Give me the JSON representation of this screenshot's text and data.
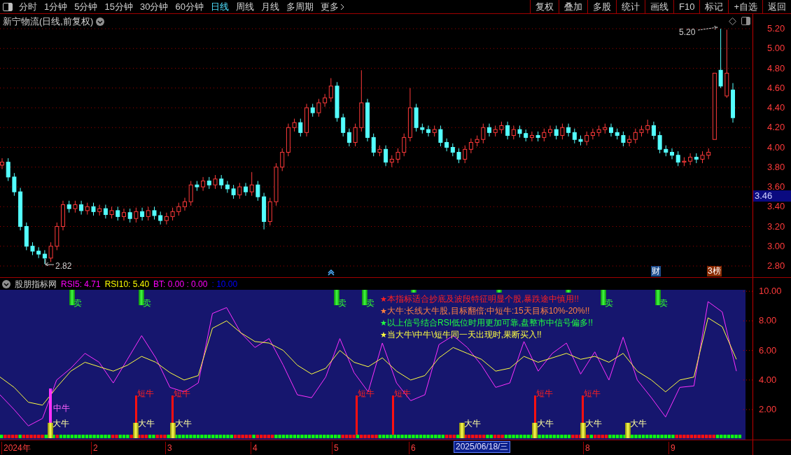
{
  "toolbar": {
    "periods": [
      {
        "label": "分时",
        "selected": false
      },
      {
        "label": "1分钟",
        "selected": false
      },
      {
        "label": "5分钟",
        "selected": false
      },
      {
        "label": "15分钟",
        "selected": false
      },
      {
        "label": "30分钟",
        "selected": false
      },
      {
        "label": "60分钟",
        "selected": false
      },
      {
        "label": "日线",
        "selected": true
      },
      {
        "label": "周线",
        "selected": false
      },
      {
        "label": "月线",
        "selected": false
      },
      {
        "label": "多周期",
        "selected": false
      }
    ],
    "more": "更多",
    "actions": [
      "复权",
      "叠加",
      "多股",
      "统计",
      "画线",
      "F10",
      "标记",
      "+自选",
      "返回"
    ]
  },
  "chart": {
    "title": "新宁物流(日线,前复权)",
    "current_price": "3.46",
    "high_marker": "5.20",
    "low_marker": "2.82",
    "event_tags": [
      {
        "label": "财",
        "color": "#1f4f8f"
      },
      {
        "label": "3榜",
        "color": "#8a2a00"
      }
    ],
    "chart_data": {
      "type": "candlestick",
      "ylim": [
        2.8,
        5.2
      ],
      "grid": true,
      "yticks": [
        {
          "value": 5.2,
          "label": "5.20"
        },
        {
          "value": 5.0,
          "label": "5.00"
        },
        {
          "value": 4.8,
          "label": "4.80"
        },
        {
          "value": 4.6,
          "label": "4.60"
        },
        {
          "value": 4.4,
          "label": "4.40"
        },
        {
          "value": 4.2,
          "label": "4.20"
        },
        {
          "value": 4.0,
          "label": "4.00"
        },
        {
          "value": 3.8,
          "label": "3.80"
        },
        {
          "value": 3.6,
          "label": "3.60"
        },
        {
          "value": 3.4,
          "label": "3.40"
        },
        {
          "value": 3.2,
          "label": "3.20"
        },
        {
          "value": 3.0,
          "label": "3.00"
        },
        {
          "value": 2.8,
          "label": "2.80"
        }
      ],
      "ohlc": [
        [
          3.82,
          3.89,
          3.78,
          3.85
        ],
        [
          3.85,
          3.89,
          3.66,
          3.7
        ],
        [
          3.7,
          3.74,
          3.51,
          3.55
        ],
        [
          3.55,
          3.59,
          3.16,
          3.2
        ],
        [
          3.2,
          3.24,
          2.96,
          3.0
        ],
        [
          3.0,
          3.04,
          2.91,
          2.95
        ],
        [
          2.95,
          2.99,
          2.88,
          2.92
        ],
        [
          2.92,
          2.96,
          2.82,
          2.88
        ],
        [
          2.88,
          3.04,
          2.84,
          3.0
        ],
        [
          3.0,
          3.24,
          2.96,
          3.2
        ],
        [
          3.2,
          3.46,
          3.16,
          3.42
        ],
        [
          3.42,
          3.46,
          3.34,
          3.38
        ],
        [
          3.38,
          3.46,
          3.34,
          3.42
        ],
        [
          3.42,
          3.46,
          3.32,
          3.36
        ],
        [
          3.36,
          3.44,
          3.32,
          3.4
        ],
        [
          3.4,
          3.44,
          3.31,
          3.35
        ],
        [
          3.35,
          3.42,
          3.31,
          3.38
        ],
        [
          3.38,
          3.42,
          3.28,
          3.32
        ],
        [
          3.32,
          3.4,
          3.28,
          3.36
        ],
        [
          3.36,
          3.4,
          3.26,
          3.3
        ],
        [
          3.3,
          3.38,
          3.26,
          3.34
        ],
        [
          3.34,
          3.38,
          3.24,
          3.28
        ],
        [
          3.28,
          3.39,
          3.24,
          3.35
        ],
        [
          3.35,
          3.39,
          3.26,
          3.3
        ],
        [
          3.3,
          3.4,
          3.26,
          3.36
        ],
        [
          3.36,
          3.4,
          3.27,
          3.31
        ],
        [
          3.31,
          3.35,
          3.22,
          3.26
        ],
        [
          3.26,
          3.34,
          3.22,
          3.3
        ],
        [
          3.3,
          3.39,
          3.26,
          3.35
        ],
        [
          3.35,
          3.44,
          3.31,
          3.4
        ],
        [
          3.4,
          3.49,
          3.36,
          3.45
        ],
        [
          3.45,
          3.66,
          3.41,
          3.62
        ],
        [
          3.62,
          3.66,
          3.56,
          3.6
        ],
        [
          3.6,
          3.7,
          3.56,
          3.66
        ],
        [
          3.66,
          3.7,
          3.58,
          3.62
        ],
        [
          3.62,
          3.72,
          3.58,
          3.68
        ],
        [
          3.68,
          3.72,
          3.58,
          3.62
        ],
        [
          3.62,
          3.66,
          3.54,
          3.58
        ],
        [
          3.58,
          3.62,
          3.48,
          3.52
        ],
        [
          3.52,
          3.64,
          3.48,
          3.6
        ],
        [
          3.6,
          3.64,
          3.51,
          3.55
        ],
        [
          3.55,
          3.75,
          3.51,
          3.62
        ],
        [
          3.62,
          3.66,
          3.46,
          3.5
        ],
        [
          3.5,
          3.54,
          3.17,
          3.25
        ],
        [
          3.25,
          3.49,
          3.21,
          3.45
        ],
        [
          3.45,
          3.84,
          3.41,
          3.8
        ],
        [
          3.8,
          3.99,
          3.76,
          3.95
        ],
        [
          3.95,
          4.24,
          3.91,
          4.2
        ],
        [
          4.2,
          4.29,
          4.16,
          4.25
        ],
        [
          4.25,
          4.29,
          4.11,
          4.15
        ],
        [
          4.15,
          4.44,
          4.11,
          4.4
        ],
        [
          4.4,
          4.44,
          4.31,
          4.35
        ],
        [
          4.35,
          4.49,
          4.31,
          4.45
        ],
        [
          4.45,
          4.54,
          4.41,
          4.5
        ],
        [
          4.5,
          4.7,
          4.46,
          4.62
        ],
        [
          4.62,
          4.66,
          4.26,
          4.3
        ],
        [
          4.3,
          4.34,
          4.11,
          4.15
        ],
        [
          4.15,
          4.19,
          4.01,
          4.05
        ],
        [
          4.05,
          4.24,
          4.01,
          4.2
        ],
        [
          4.2,
          4.78,
          4.16,
          4.45
        ],
        [
          4.45,
          4.49,
          4.06,
          4.1
        ],
        [
          4.1,
          4.14,
          3.91,
          3.95
        ],
        [
          3.95,
          4.02,
          3.91,
          3.98
        ],
        [
          3.98,
          4.02,
          3.81,
          3.85
        ],
        [
          3.85,
          3.92,
          3.8,
          3.88
        ],
        [
          3.88,
          3.99,
          3.84,
          3.95
        ],
        [
          3.95,
          4.14,
          3.91,
          4.1
        ],
        [
          4.1,
          4.6,
          4.06,
          4.4
        ],
        [
          4.4,
          4.44,
          4.16,
          4.2
        ],
        [
          4.2,
          4.24,
          4.14,
          4.18
        ],
        [
          4.18,
          4.22,
          4.11,
          4.15
        ],
        [
          4.15,
          4.22,
          4.11,
          4.18
        ],
        [
          4.18,
          4.22,
          4.01,
          4.05
        ],
        [
          4.05,
          4.09,
          3.96,
          4.0
        ],
        [
          4.0,
          4.04,
          3.91,
          3.95
        ],
        [
          3.95,
          3.99,
          3.84,
          3.88
        ],
        [
          3.88,
          4.02,
          3.84,
          3.98
        ],
        [
          3.98,
          4.09,
          3.94,
          4.05
        ],
        [
          4.05,
          4.12,
          4.01,
          4.08
        ],
        [
          4.08,
          4.24,
          4.04,
          4.2
        ],
        [
          4.2,
          4.24,
          4.11,
          4.15
        ],
        [
          4.15,
          4.22,
          4.11,
          4.18
        ],
        [
          4.18,
          4.26,
          4.14,
          4.22
        ],
        [
          4.22,
          4.26,
          4.08,
          4.12
        ],
        [
          4.12,
          4.22,
          4.08,
          4.18
        ],
        [
          4.18,
          4.22,
          4.1,
          4.14
        ],
        [
          4.14,
          4.18,
          4.06,
          4.1
        ],
        [
          4.1,
          4.16,
          4.06,
          4.12
        ],
        [
          4.12,
          4.16,
          4.06,
          4.1
        ],
        [
          4.1,
          4.19,
          4.06,
          4.15
        ],
        [
          4.15,
          4.22,
          4.11,
          4.18
        ],
        [
          4.18,
          4.22,
          4.08,
          4.12
        ],
        [
          4.12,
          4.24,
          4.08,
          4.2
        ],
        [
          4.2,
          4.24,
          4.11,
          4.15
        ],
        [
          4.15,
          4.19,
          4.04,
          4.08
        ],
        [
          4.08,
          4.12,
          4.02,
          4.06
        ],
        [
          4.06,
          4.16,
          4.02,
          4.12
        ],
        [
          4.12,
          4.19,
          4.08,
          4.15
        ],
        [
          4.15,
          4.22,
          4.11,
          4.18
        ],
        [
          4.18,
          4.24,
          4.14,
          4.2
        ],
        [
          4.2,
          4.24,
          4.11,
          4.15
        ],
        [
          4.15,
          4.19,
          4.08,
          4.12
        ],
        [
          4.12,
          4.16,
          4.01,
          4.05
        ],
        [
          4.05,
          4.12,
          4.01,
          4.08
        ],
        [
          4.08,
          4.19,
          4.04,
          4.15
        ],
        [
          4.15,
          4.22,
          4.11,
          4.18
        ],
        [
          4.18,
          4.28,
          4.14,
          4.22
        ],
        [
          4.22,
          4.26,
          4.08,
          4.12
        ],
        [
          4.12,
          4.16,
          3.94,
          3.98
        ],
        [
          3.98,
          4.02,
          3.91,
          3.95
        ],
        [
          3.95,
          3.99,
          3.88,
          3.92
        ],
        [
          3.92,
          3.96,
          3.81,
          3.85
        ],
        [
          3.85,
          3.9,
          3.81,
          3.86
        ],
        [
          3.86,
          3.94,
          3.82,
          3.9
        ],
        [
          3.9,
          3.94,
          3.84,
          3.88
        ],
        [
          3.88,
          3.96,
          3.84,
          3.92
        ],
        [
          3.92,
          3.99,
          3.88,
          3.95
        ],
        [
          4.08,
          4.75,
          4.08,
          4.75
        ],
        [
          4.78,
          5.2,
          4.6,
          4.62
        ],
        [
          4.52,
          5.19,
          4.5,
          4.75
        ],
        [
          4.58,
          4.65,
          4.25,
          4.3
        ]
      ]
    }
  },
  "indicator": {
    "name": "股朋指标网",
    "values": [
      {
        "text": "RSI5: 4.71",
        "color": "#ff00ff"
      },
      {
        "text": "RSI10: 5.40",
        "color": "#ffff00"
      },
      {
        "text": "BT: 0.00 : 0.00",
        "color": "#ff00ff"
      },
      {
        "text": ": 10.00",
        "color": "#0000ff"
      }
    ],
    "notes": [
      {
        "bullet": "★",
        "text": "本指标适合抄底及波段特征明显个股,暴跌途中慎用!!",
        "color": "#ff2020"
      },
      {
        "bullet": "★",
        "text": "大牛:长线大牛股,目标翻倍;中短牛:15天目标10%-20%!!",
        "color": "#ff8040"
      },
      {
        "bullet": "★",
        "text": "以上信号结合RSI低位时用更加可靠,盘整市中信号偏多!!",
        "color": "#20ff40"
      },
      {
        "bullet": "★",
        "text": "当大牛\\中牛\\短牛同一天出现时,果断买入!!",
        "color": "#ffff40"
      }
    ],
    "chart_data": {
      "type": "line",
      "ylim": [
        -0.03,
        10.1
      ],
      "yticks": [
        {
          "value": 10,
          "label": "10.00"
        },
        {
          "value": 8,
          "label": "8.00"
        },
        {
          "value": 6,
          "label": "6.00"
        },
        {
          "value": 4,
          "label": "4.00"
        },
        {
          "value": 2,
          "label": "2.00"
        }
      ],
      "series": [
        {
          "color": "#ff30ff",
          "values": [
            3.0,
            2.0,
            0.9,
            1.4,
            4.0,
            4.8,
            5.8,
            5.2,
            3.8,
            5.4,
            7.0,
            5.5,
            3.5,
            3.2,
            3.8,
            8.5,
            8.9,
            7.2,
            6.2,
            6.8,
            5.0,
            3.0,
            2.8,
            4.2,
            6.8,
            4.5,
            3.2,
            6.5,
            3.8,
            2.6,
            3.0,
            6.4,
            7.0,
            6.2,
            5.0,
            3.5,
            3.8,
            6.6,
            4.6,
            5.8,
            6.5,
            4.4,
            5.9,
            4.0,
            6.9,
            4.0,
            2.8,
            1.5,
            3.5,
            3.6,
            9.3,
            8.6,
            4.6
          ]
        },
        {
          "color": "#ffff40",
          "values": [
            4.2,
            3.5,
            2.5,
            2.3,
            3.5,
            4.6,
            5.2,
            4.9,
            4.6,
            5.0,
            5.6,
            5.2,
            4.5,
            4.0,
            4.3,
            7.5,
            8.0,
            7.2,
            6.6,
            6.5,
            6.0,
            5.0,
            4.4,
            4.8,
            6.0,
            5.2,
            4.9,
            5.5,
            4.6,
            4.0,
            4.3,
            5.5,
            6.2,
            5.8,
            5.4,
            4.6,
            4.8,
            5.6,
            5.2,
            5.5,
            5.8,
            5.4,
            5.6,
            5.2,
            5.8,
            4.6,
            4.0,
            3.2,
            4.0,
            4.2,
            8.2,
            7.6,
            5.4
          ]
        }
      ]
    },
    "signals": [
      {
        "kind": "sell",
        "label": "卖"
      },
      {
        "kind": "sell",
        "label": "卖"
      },
      {
        "kind": "sell",
        "label": "卖"
      },
      {
        "kind": "sell",
        "label": "卖"
      },
      {
        "kind": "sell"
      },
      {
        "kind": "sell"
      },
      {
        "kind": "sell"
      },
      {
        "kind": "sell",
        "label": "卖"
      },
      {
        "kind": "sell",
        "label": "卖"
      },
      {
        "kind": "mid",
        "label": "中牛"
      },
      {
        "kind": "short",
        "label": "短牛"
      },
      {
        "kind": "short",
        "label": "短牛"
      },
      {
        "kind": "short",
        "label": "短牛"
      },
      {
        "kind": "short",
        "label": "短牛"
      },
      {
        "kind": "short",
        "label": "短牛"
      },
      {
        "kind": "short",
        "label": "短牛"
      },
      {
        "kind": "big",
        "label": "大牛"
      },
      {
        "kind": "big",
        "label": "大牛"
      },
      {
        "kind": "big",
        "label": "大牛"
      },
      {
        "kind": "big",
        "label": "大牛"
      },
      {
        "kind": "big",
        "label": "大牛"
      },
      {
        "kind": "big",
        "label": "大牛"
      },
      {
        "kind": "big",
        "label": "大牛"
      }
    ]
  },
  "date_axis": {
    "labels": [
      "2024年",
      "2",
      "3",
      "4",
      "5",
      "6",
      "8",
      "9"
    ],
    "cursor_date": "2025/06/18/三"
  }
}
